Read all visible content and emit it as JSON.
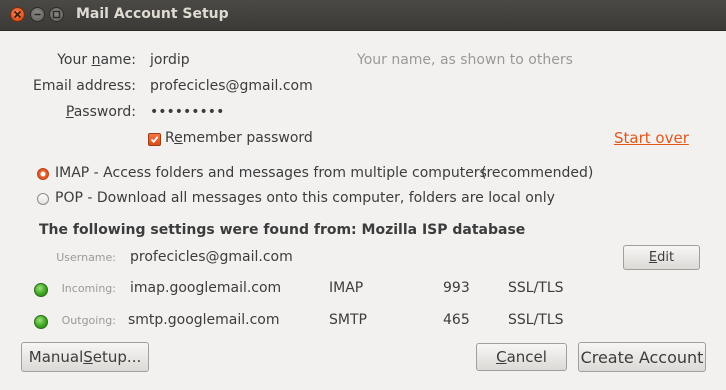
{
  "window": {
    "title": "Mail Account Setup"
  },
  "form": {
    "name_label_pre": "Your ",
    "name_label_u": "n",
    "name_label_post": "ame:",
    "name_value": "jordip",
    "name_hint": "Your name, as shown to others",
    "email_label": "Email address:",
    "email_value": "profecicles@gmail.com",
    "password_label_u": "P",
    "password_label_post": "assword:",
    "password_value": "•••••••••",
    "remember_label_pre": "R",
    "remember_label_u": "e",
    "remember_label_post": "member password",
    "remember_checked": true,
    "start_over": "Start over"
  },
  "protocols": {
    "imap_label": "IMAP - Access folders and messages from multiple computers",
    "imap_recommended": "(recommended)",
    "imap_selected": true,
    "pop_label": "POP - Download all messages onto this computer, folders are local only",
    "pop_selected": false
  },
  "settings": {
    "heading": "The following settings were found from: Mozilla ISP database",
    "username_label": "Username:",
    "username_value": "profecicles@gmail.com",
    "edit_label": "Edit",
    "edit_u": "E",
    "edit_post": "dit",
    "incoming": {
      "label": "Incoming:",
      "server": "imap.googlemail.com",
      "protocol": "IMAP",
      "port": "993",
      "security": "SSL/TLS",
      "status_color": "#3fa51f"
    },
    "outgoing": {
      "label": "Outgoing:",
      "server": "smtp.googlemail.com",
      "protocol": "SMTP",
      "port": "465",
      "security": "SSL/TLS",
      "status_color": "#3fa51f"
    }
  },
  "buttons": {
    "manual_pre": "Manual ",
    "manual_u": "S",
    "manual_post": "etup...",
    "cancel_u": "C",
    "cancel_post": "ancel",
    "create": "Create Account"
  },
  "colors": {
    "accent": "#e0571d",
    "titlebar": "#3c3b37",
    "background": "#f2f1f0"
  }
}
